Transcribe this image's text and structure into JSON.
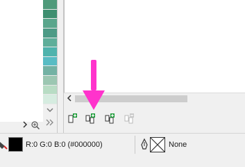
{
  "palette": {
    "swatches": [
      "#4f9a7a",
      "#3f8f70",
      "#5aa68c",
      "#4d9b86",
      "#5fae9a",
      "#4fb3ad",
      "#58bcc4",
      "#73b2a4",
      "#9cc7b2",
      "#b8dcc4",
      "#d6ece0"
    ],
    "scroll_down_icon": "chevron-down-icon",
    "more_icon": "double-chevron-right-icon"
  },
  "status": {
    "fill_color": "#000000",
    "fill_text": "R:0 G:0 B:0 (#000000)",
    "outline_text": "None"
  },
  "annotation": {
    "arrow_color": "#ff33cc"
  },
  "page_buttons": [
    {
      "name": "insert-page-before-button",
      "enabled": true
    },
    {
      "name": "insert-page-button",
      "enabled": true
    },
    {
      "name": "insert-page-after-button",
      "enabled": true
    },
    {
      "name": "delete-page-button",
      "enabled": false
    }
  ]
}
